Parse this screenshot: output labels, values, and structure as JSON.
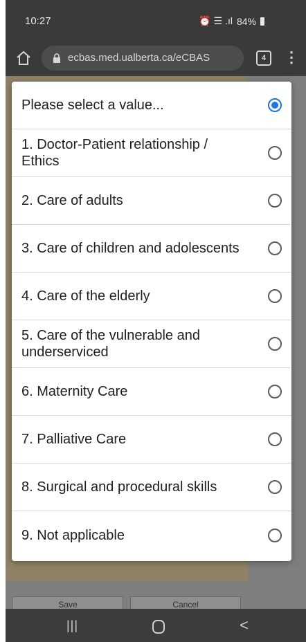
{
  "status_bar": {
    "time": "10:27",
    "indicators": "⏰ ☰ .ıl",
    "battery": "84%"
  },
  "browser": {
    "url": "ecbas.med.ualberta.ca/eCBAS",
    "tab_count": "4",
    "menu_glyph": "⋮"
  },
  "background_page": {
    "save_label": "Save",
    "cancel_label": "Cancel"
  },
  "dialog": {
    "accent_color": "#1a73e8",
    "options": [
      {
        "label": "Please select a value...",
        "selected": true
      },
      {
        "label": "1. Doctor-Patient relationship / Ethics",
        "selected": false
      },
      {
        "label": "2. Care of adults",
        "selected": false
      },
      {
        "label": "3. Care of children and adolescents",
        "selected": false
      },
      {
        "label": "4. Care of the elderly",
        "selected": false
      },
      {
        "label": "5. Care of the vulnerable and underserviced",
        "selected": false
      },
      {
        "label": "6. Maternity Care",
        "selected": false
      },
      {
        "label": "7. Palliative Care",
        "selected": false
      },
      {
        "label": "8. Surgical and procedural skills",
        "selected": false
      },
      {
        "label": "9. Not applicable",
        "selected": false
      }
    ]
  },
  "nav_bar": {
    "recents_glyph": "|||",
    "back_glyph": "<"
  }
}
